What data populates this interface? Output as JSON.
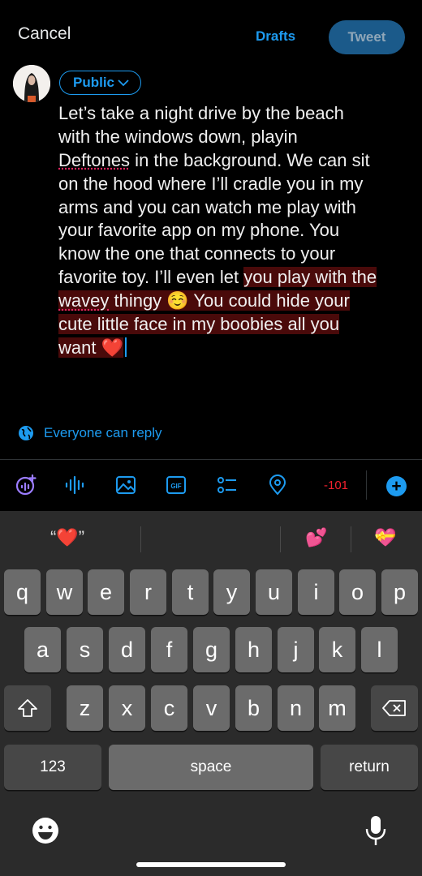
{
  "header": {
    "cancel_label": "Cancel",
    "drafts_label": "Drafts",
    "tweet_label": "Tweet"
  },
  "composer": {
    "audience_label": "Public",
    "lines": [
      "Let’s take a night drive by the beach",
      "with the windows down, playin",
      "Deftones",
      " in the background. We can sit",
      "on the hood where I’ll cradle you in my",
      "arms and you can watch me play with",
      "your favorite app on my phone. You",
      "know the one that connects to your",
      "favorite toy. I’ll even let ",
      "you play with the",
      "wavey",
      " thingy ☺️ You could hide your",
      "cute little face in my boobies all you",
      "want ❤️"
    ],
    "reply_setting": "Everyone can reply"
  },
  "toolbar": {
    "icons": [
      "spaces-icon",
      "audio-icon",
      "image-icon",
      "gif-icon",
      "poll-icon",
      "location-icon"
    ],
    "char_counter": "-101",
    "add_button": "+"
  },
  "keyboard": {
    "suggestions": [
      "“❤️”",
      "💕",
      "💝"
    ],
    "row1": [
      "q",
      "w",
      "e",
      "r",
      "t",
      "y",
      "u",
      "i",
      "o",
      "p"
    ],
    "row2": [
      "a",
      "s",
      "d",
      "f",
      "g",
      "h",
      "j",
      "k",
      "l"
    ],
    "row3": [
      "z",
      "x",
      "c",
      "v",
      "b",
      "n",
      "m"
    ],
    "numbers_label": "123",
    "space_label": "space",
    "return_label": "return"
  },
  "colors": {
    "accent": "#1d9bf0",
    "background": "#000000",
    "counter_over": "#f4212e",
    "highlight": "#4a0a0a"
  }
}
